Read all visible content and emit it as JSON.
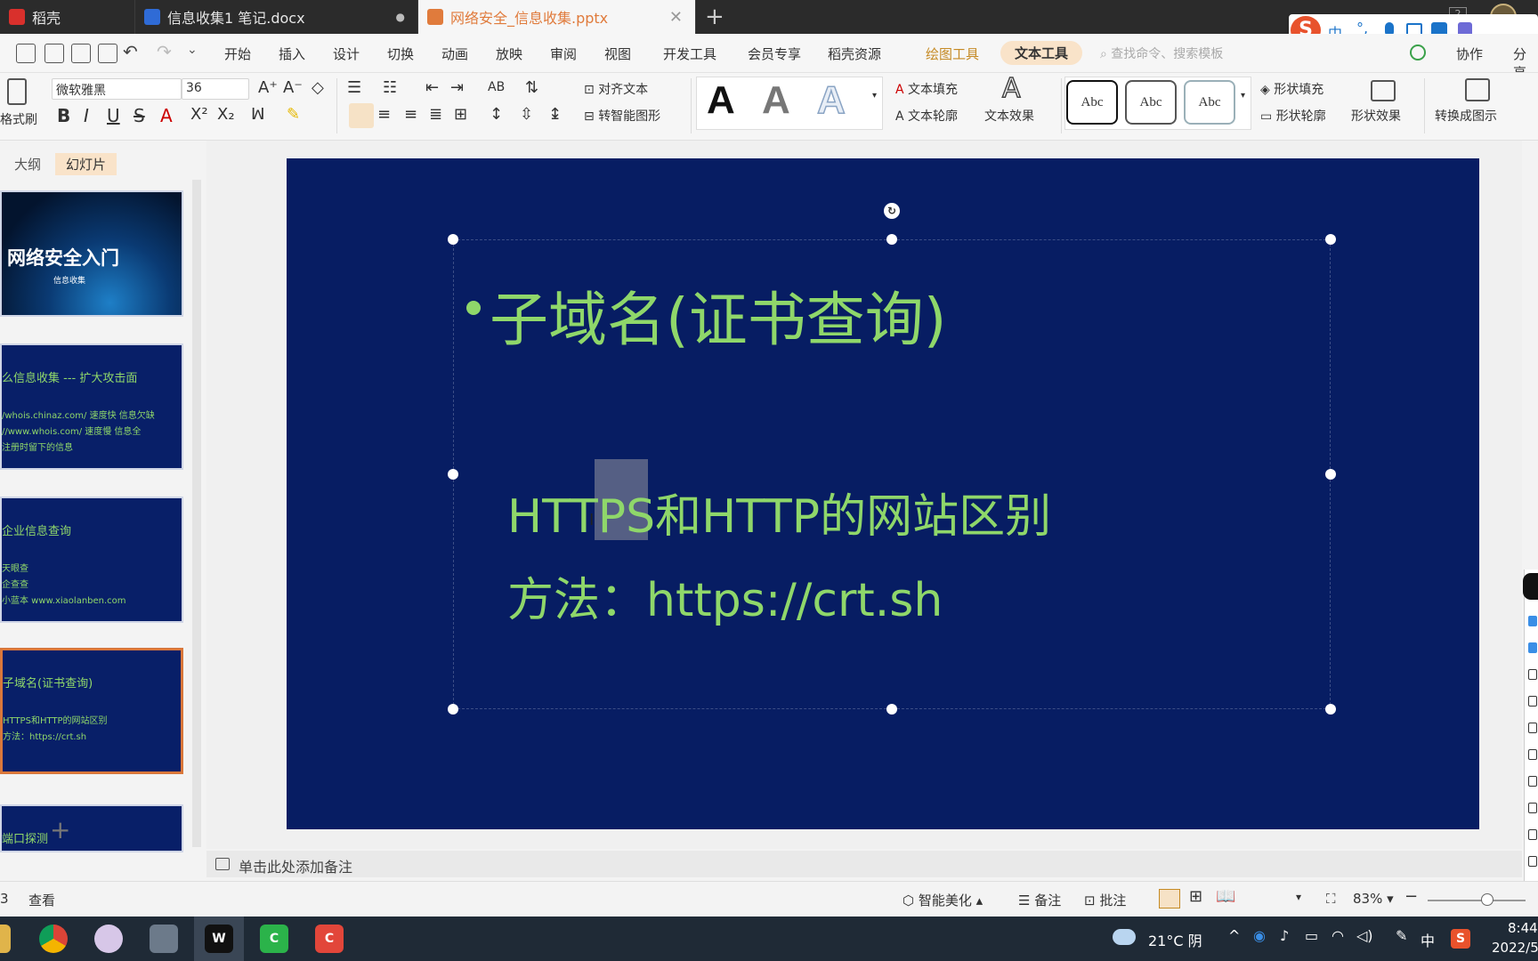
{
  "tabs": [
    {
      "label": "稻壳",
      "icon": "docer-icon"
    },
    {
      "label": "信息收集1 笔记.docx",
      "icon": "word-doc-icon"
    },
    {
      "label": "网络安全_信息收集.pptx",
      "icon": "ppt-icon"
    }
  ],
  "window_badge": "2",
  "menu": {
    "items": [
      "开始",
      "插入",
      "设计",
      "切换",
      "动画",
      "放映",
      "审阅",
      "视图",
      "开发工具",
      "会员专享",
      "稻壳资源"
    ],
    "tool_tabs": [
      "绘图工具",
      "文本工具"
    ],
    "search_placeholder": "查找命令、搜索模板",
    "collab": "协作",
    "share": "分享"
  },
  "ribbon": {
    "format_painter": "格式刷",
    "font_name": "微软雅黑",
    "font_size": "36",
    "align_text": "对齐文本",
    "smart_shape": "转智能图形",
    "text_fill": "文本填充",
    "text_outline": "文本轮廓",
    "text_effect": "文本效果",
    "style_sample": "Abc",
    "shape_fill": "形状填充",
    "shape_outline": "形状轮廓",
    "shape_effect": "形状效果",
    "convert": "转换成图示",
    "bigA": "A"
  },
  "panel": {
    "tab_outline": "大纲",
    "tab_slides": "幻灯片",
    "thumbs": [
      {
        "title": "网络安全入门",
        "subtitle": "信息收集"
      },
      {
        "title": "么信息收集 --- 扩大攻击面",
        "lines": [
          "/whois.chinaz.com/ 速度快 信息欠缺",
          "//www.whois.com/ 速度慢 信息全",
          "注册时留下的信息"
        ]
      },
      {
        "title": "企业信息查询",
        "lines": [
          "天眼查",
          "企查查",
          "小蓝本 www.xiaolanben.com"
        ]
      },
      {
        "title": "子域名(证书查询)",
        "lines": [
          "HTTPS和HTTP的网站区别",
          "方法：https://crt.sh"
        ]
      },
      {
        "title": "端口探测",
        "lines": []
      }
    ]
  },
  "slide": {
    "title": "子域名(证书查询)",
    "line1_a": "HTT",
    "line1_b": "PS",
    "line1_c": "和HTTP的网站区别",
    "line2": "方法：https://crt.sh"
  },
  "notes_placeholder": "单击此处添加备注",
  "status": {
    "page_num": "3",
    "view": "查看",
    "beautify": "智能美化",
    "notes": "备注",
    "comment": "批注",
    "zoom": "83%"
  },
  "taskbar": {
    "weather": "21°C 阴",
    "ime": "中",
    "time": "8:44",
    "date": "2022/5"
  },
  "ime_bar": {
    "mode": "中"
  },
  "colors": {
    "slide_bg": "#071d63",
    "slide_text": "#8fd76a",
    "active_tab": "#e07b3c",
    "tool_tab": "#c58a24"
  }
}
